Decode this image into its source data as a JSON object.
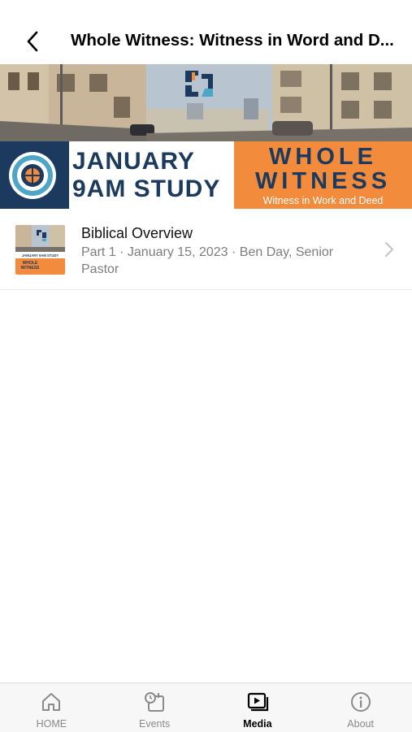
{
  "status_bar": {
    "time": ""
  },
  "header": {
    "back_icon": "chevron-left-icon",
    "title": "Whole Witness: Witness in Word and D..."
  },
  "banner": {
    "line1": "JANUARY",
    "line2": "9AM STUDY",
    "ww_line1": "WHOLE",
    "ww_line2": "WITNESS",
    "ww_subtitle": "Witness in Work and Deed",
    "colors": {
      "navy": "#1b3a5e",
      "orange": "#f28b3c"
    }
  },
  "media_items": [
    {
      "title": "Biblical Overview",
      "subtitle": "Part 1 · January 15, 2023 · Ben Day, Senior Pastor",
      "thumb_line1": "JANUARY 9AM STUDY",
      "thumb_line2": "WHOLE",
      "thumb_line3": "WITNESS"
    }
  ],
  "tab_bar": {
    "tabs": [
      {
        "label": "HOME",
        "icon": "home-icon",
        "active": false
      },
      {
        "label": "Events",
        "icon": "calendar-clock-icon",
        "active": false
      },
      {
        "label": "Media",
        "icon": "play-media-icon",
        "active": true
      },
      {
        "label": "About",
        "icon": "info-icon",
        "active": false
      }
    ]
  }
}
